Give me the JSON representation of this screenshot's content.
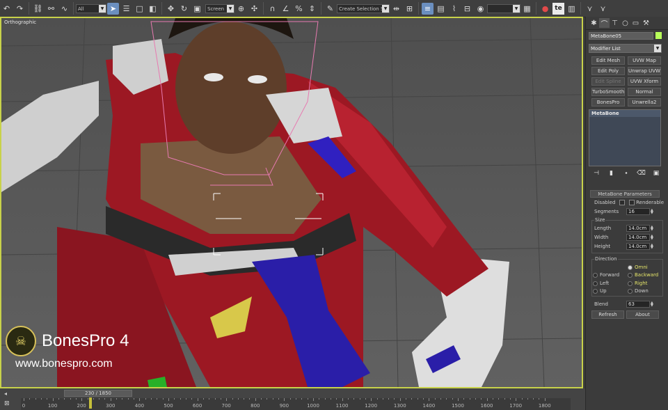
{
  "toolbar": {
    "selection_filter": "All",
    "ref_coord": "Screen",
    "named_selection": "Create Selection Se",
    "app_letters": "te"
  },
  "viewport": {
    "label": "Orthographic"
  },
  "watermark": {
    "title": "BonesPro 4",
    "url": "www.bonespro.com"
  },
  "command_panel": {
    "object_name": "MetaBone05",
    "color": "#b8ff5a",
    "modifier_list": "Modifier List",
    "modifier_buttons": [
      "Edit Mesh",
      "UVW Map",
      "Edit Poly",
      "Unwrap UVW",
      "Edit Spline",
      "UVW Xform",
      "TurboSmooth",
      "Normal",
      "BonesPro",
      "Unwrella2"
    ],
    "stack_item": "MetaBone",
    "params": {
      "title": "MetaBone Parameters",
      "disabled_label": "Disabled",
      "renderable_label": "Renderable",
      "segments_label": "Segments",
      "segments_value": "16",
      "size_label": "Size",
      "length_label": "Length",
      "length_value": "14.0cm",
      "width_label": "Width",
      "width_value": "14.0cm",
      "height_label": "Height",
      "height_value": "14.0cm",
      "direction_label": "Direction",
      "omni": "Omni",
      "forward": "Forward",
      "backward": "Backward",
      "left": "Left",
      "right": "Right",
      "up": "Up",
      "down": "Down",
      "blend_label": "Blend",
      "blend_value": "63",
      "refresh": "Refresh",
      "about": "About"
    }
  },
  "timeline": {
    "frame_display": "230 / 1850",
    "current_frame": 230,
    "total_frames": 1850,
    "ticks": [
      "0",
      "100",
      "200",
      "300",
      "400",
      "500",
      "600",
      "700",
      "800",
      "900",
      "1000",
      "1100",
      "1200",
      "1300",
      "1400",
      "1500",
      "1600",
      "1700",
      "1800"
    ]
  }
}
